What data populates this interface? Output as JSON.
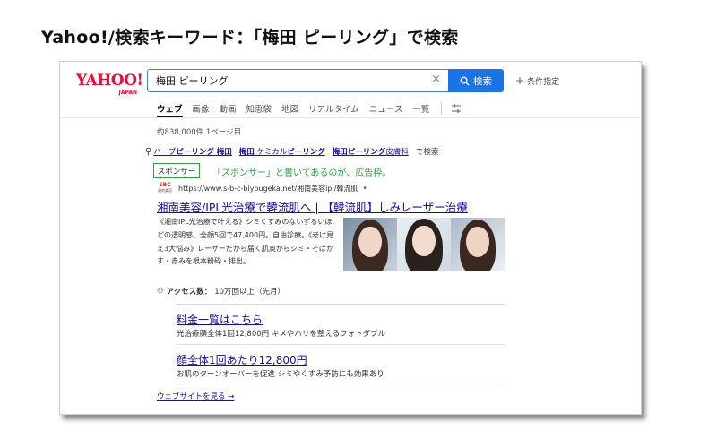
{
  "page_heading": "Yahoo!/検索キーワード：「梅田 ピーリング」で検索",
  "header": {
    "logo_main": "YAHOO!",
    "logo_sub": "JAPAN",
    "search_value": "梅田 ピーリング",
    "clear_icon": "close-icon",
    "search_button_label": "検索",
    "conditions_label": "条件指定"
  },
  "tabs": [
    "ウェブ",
    "画像",
    "動画",
    "知恵袋",
    "地図",
    "リアルタイム",
    "ニュース",
    "一覧"
  ],
  "active_tab": "ウェブ",
  "result_count": "約838,000件  1ページ目",
  "related": [
    {
      "pre": "ハーブ",
      "bold": "ピーリング 梅田"
    },
    {
      "pre": "",
      "bold": "梅田",
      "post": " ケミカル",
      "bold2": "ピーリング"
    },
    {
      "pre": "",
      "bold": "梅田ピーリング",
      "post": "皮膚科"
    }
  ],
  "related_suffix": "で検索",
  "sponsor_label": "スポンサー",
  "sponsor_note": "「スポンサー」と書いてあるのが、広告枠。",
  "ad": {
    "favicon_top": "SBC",
    "favicon_bottom": "湘南美容",
    "url": "https://www.s-b-c-biyougeka.net/湘南美容ipl/韓流肌",
    "title": "湘南美容/IPL光治療で韓流肌へ | 【韓流肌】しみレーザー治療",
    "description": "《湘南IPL光治療で叶える》シミくすみのないずるいほどの透明感、全顔5回で47,400円。自由診療。《老け見え3大悩み》レーザーだから届く肌奥からシミ・そばかす・赤みを根本粉砕・排出。",
    "access_label": "アクセス数：",
    "access_value": "10万回以上（先月）"
  },
  "sitelinks": [
    {
      "title": "料金一覧はこちら",
      "desc": "光治療顔全体1回12,800円 キメやハリを整えるフォトダブル"
    },
    {
      "title": "顔全体1回あたり12,800円",
      "desc": "お肌のターンオーバーを促進 シミやくすみ予防にも効果あり"
    }
  ],
  "visit_label": "ウェブサイトを見る →",
  "colors": {
    "accent": "#1a73e8",
    "link": "#1a0dab",
    "sponsor_green": "#2ea14a",
    "logo_red": "#ff0033"
  }
}
